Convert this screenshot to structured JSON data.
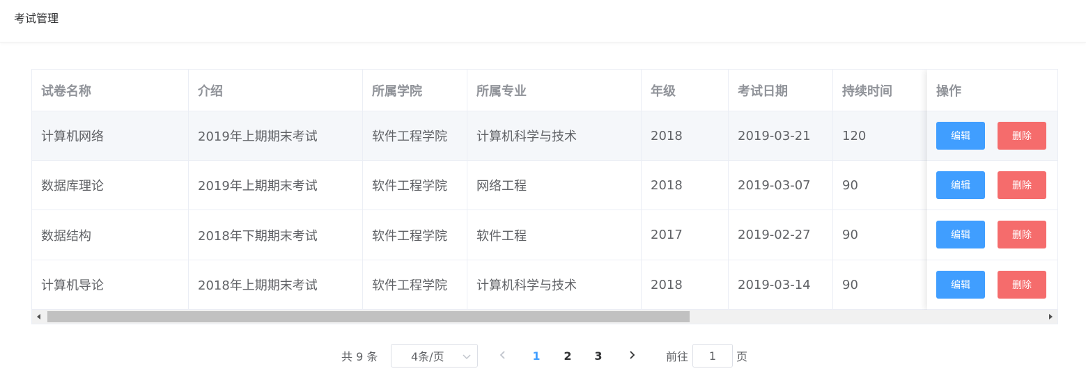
{
  "header": {
    "title": "考试管理"
  },
  "table": {
    "columns": [
      "试卷名称",
      "介绍",
      "所属学院",
      "所属专业",
      "年级",
      "考试日期",
      "持续时间"
    ],
    "action_column": "操作",
    "rows": [
      {
        "name": "计算机网络",
        "intro": "2019年上期期末考试",
        "college": "软件工程学院",
        "major": "计算机科学与技术",
        "grade": "2018",
        "date": "2019-03-21",
        "duration": "120"
      },
      {
        "name": "数据库理论",
        "intro": "2019年上期期末考试",
        "college": "软件工程学院",
        "major": "网络工程",
        "grade": "2018",
        "date": "2019-03-07",
        "duration": "90"
      },
      {
        "name": "数据结构",
        "intro": "2018年下期期末考试",
        "college": "软件工程学院",
        "major": "软件工程",
        "grade": "2017",
        "date": "2019-02-27",
        "duration": "90"
      },
      {
        "name": "计算机导论",
        "intro": "2018年上期期末考试",
        "college": "软件工程学院",
        "major": "计算机科学与技术",
        "grade": "2018",
        "date": "2019-03-14",
        "duration": "90"
      }
    ],
    "edit_label": "编辑",
    "delete_label": "删除",
    "horizontal_scroll_fraction": 0.63
  },
  "pagination": {
    "total_text": "共 9 条",
    "page_size": "4条/页",
    "pages": [
      "1",
      "2",
      "3"
    ],
    "current_page": "1",
    "goto_label": "前往",
    "goto_value": "1",
    "goto_suffix": "页"
  },
  "colors": {
    "primary": "#409eff",
    "danger": "#f56c6c",
    "hover_row": "#f5f7fa"
  },
  "icons": {
    "prev": "chevron-left-icon",
    "next": "chevron-right-icon",
    "dropdown": "chevron-down-icon",
    "scroll_left": "triangle-left-icon",
    "scroll_right": "triangle-right-icon"
  }
}
